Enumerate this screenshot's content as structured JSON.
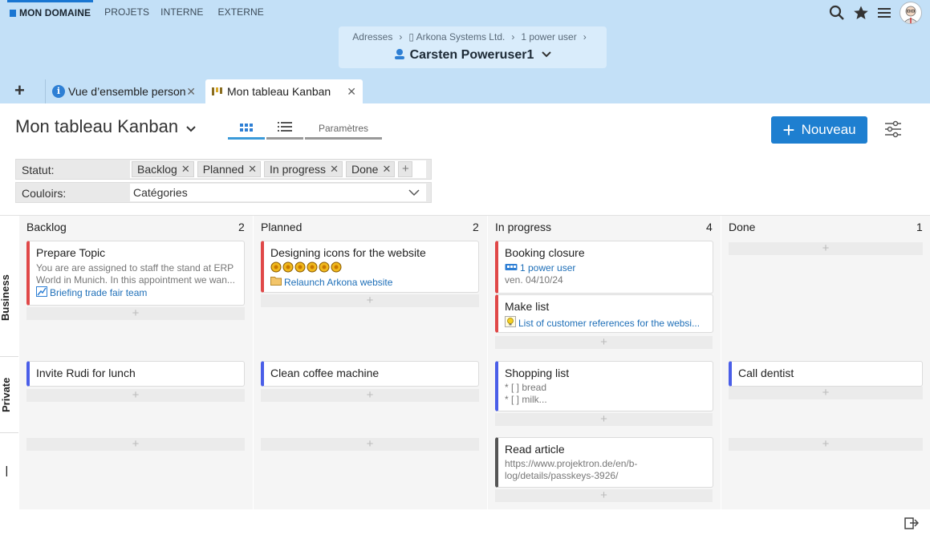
{
  "nav": {
    "items": [
      {
        "label": "MON DOMAINE",
        "active": true
      },
      {
        "label": "PROJETS"
      },
      {
        "label": "INTERNE"
      },
      {
        "label": "EXTERNE"
      }
    ]
  },
  "breadcrumb": {
    "items": [
      "Adresses",
      "Arkona Systems Ltd.",
      "1 power user"
    ],
    "current_user": "Carsten Poweruser1"
  },
  "tabs": [
    {
      "label": "Vue d’ensemble person",
      "icon": "info-icon"
    },
    {
      "label": "Mon tableau Kanban",
      "icon": "kanban-icon",
      "active": true
    }
  ],
  "board": {
    "title": "Mon tableau Kanban",
    "view_tabs": [
      "grid-view",
      "list-view",
      "Paramètres"
    ],
    "new_button": "Nouveau"
  },
  "filters": {
    "status_label": "Statut:",
    "status_chips": [
      "Backlog",
      "Planned",
      "In progress",
      "Done"
    ],
    "lanes_label": "Couloirs:",
    "lanes_value": "Catégories"
  },
  "columns": [
    {
      "name": "Backlog",
      "count": "2"
    },
    {
      "name": "Planned",
      "count": "2"
    },
    {
      "name": "In progress",
      "count": "4"
    },
    {
      "name": "Done",
      "count": "1"
    }
  ],
  "lanes": [
    "Business",
    "Private",
    "—"
  ],
  "cards": {
    "prepare_topic": {
      "title": "Prepare Topic",
      "desc1": "You are are assigned to staff the stand at ERP",
      "desc2": "World in Munich. In this appointment we wan...",
      "link": "Briefing trade fair team"
    },
    "designing_icons": {
      "title": "Designing icons for the website",
      "rating": 6,
      "link": "Relaunch Arkona website"
    },
    "booking_closure": {
      "title": "Booking closure",
      "link": "1 power user",
      "date": "ven. 04/10/24"
    },
    "make_list": {
      "title": "Make list",
      "link": "List of customer references for the websi..."
    },
    "invite_rudi": {
      "title": "Invite Rudi for lunch"
    },
    "clean_coffee": {
      "title": "Clean coffee machine"
    },
    "shopping_list": {
      "title": "Shopping list",
      "line1": "* [ ] bread",
      "line2": "* [ ] milk..."
    },
    "call_dentist": {
      "title": "Call dentist"
    },
    "read_article": {
      "title": "Read article",
      "line1": "https://www.projektron.de/en/b-",
      "line2": "log/details/passkeys-3926/"
    }
  },
  "colors": {
    "accent": "#1e7fd0",
    "header_bg": "#c3e0f7",
    "red": "#e04848",
    "blue": "#4a5ee8"
  }
}
